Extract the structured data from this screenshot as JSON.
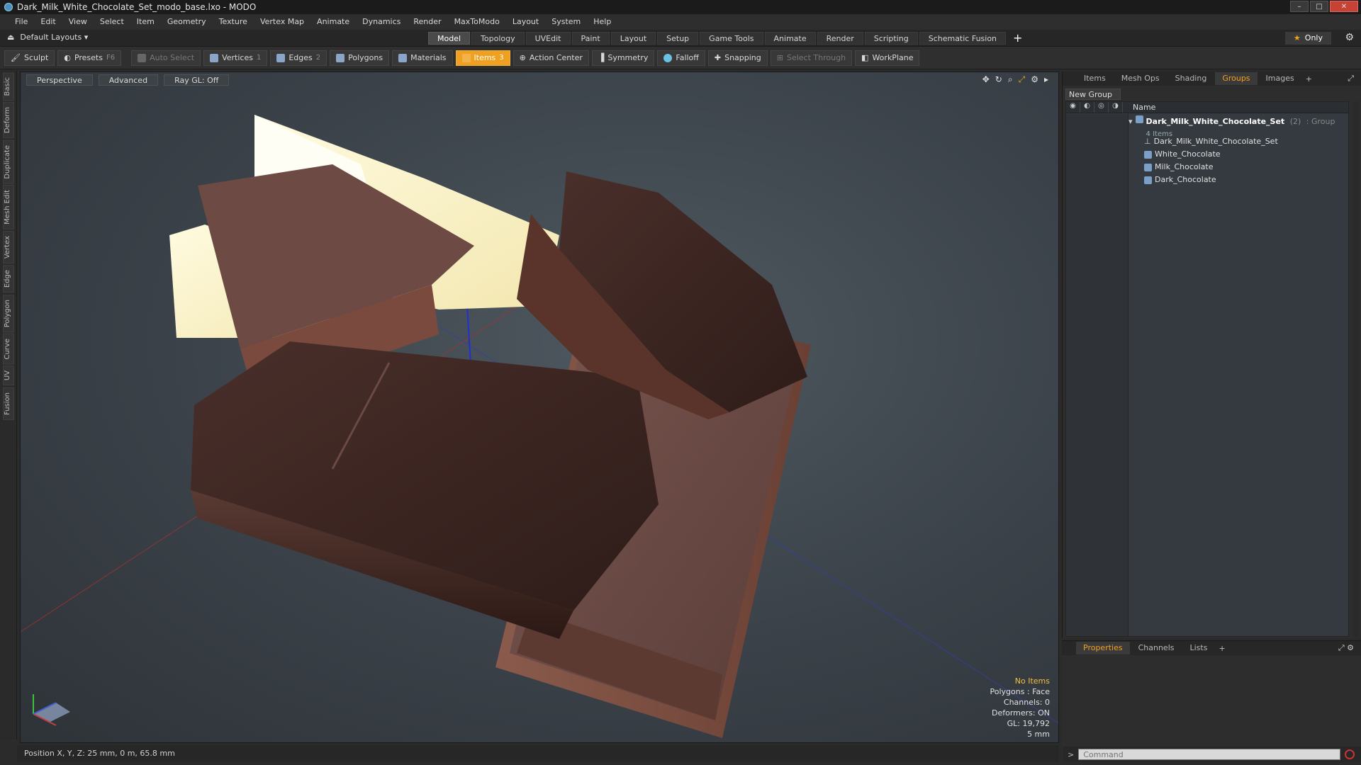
{
  "window": {
    "title": "Dark_Milk_White_Chocolate_Set_modo_base.lxo - MODO",
    "min": "–",
    "max": "□",
    "close": "✕"
  },
  "menu": [
    "File",
    "Edit",
    "View",
    "Select",
    "Item",
    "Geometry",
    "Texture",
    "Vertex Map",
    "Animate",
    "Dynamics",
    "Render",
    "MaxToModo",
    "Layout",
    "System",
    "Help"
  ],
  "layout_bar": {
    "layout_selector": "Default Layouts ▾",
    "tabs": [
      "Model",
      "Topology",
      "UVEdit",
      "Paint",
      "Layout",
      "Setup",
      "Game Tools",
      "Animate",
      "Render",
      "Scripting",
      "Schematic Fusion"
    ],
    "active_tab": "Model",
    "add": "+",
    "only": "Only"
  },
  "toolbar": {
    "sculpt": "Sculpt",
    "presets": "Presets",
    "presets_key": "F6",
    "auto_select": "Auto Select",
    "vertices": "Vertices",
    "vertices_count": "1",
    "edges": "Edges",
    "edges_count": "2",
    "polygons": "Polygons",
    "materials": "Materials",
    "items": "Items",
    "items_count": "3",
    "action_center": "Action Center",
    "symmetry": "Symmetry",
    "falloff": "Falloff",
    "snapping": "Snapping",
    "select_through": "Select Through",
    "workplane": "WorkPlane"
  },
  "left_tabs": [
    "Basic",
    "Deform",
    "Duplicate",
    "Mesh Edit",
    "Vertex",
    "Edge",
    "Polygon",
    "Curve",
    "UV",
    "Fusion"
  ],
  "viewport": {
    "view": "Perspective",
    "shading": "Advanced",
    "raygl": "Ray GL: Off",
    "info": {
      "items": "No Items",
      "polygons": "Polygons : Face",
      "channels": "Channels: 0",
      "deformers": "Deformers: ON",
      "gl": "GL: 19,792",
      "unit": "5 mm"
    }
  },
  "status": "Position X, Y, Z:  25 mm, 0 m, 65.8 mm",
  "right_panel": {
    "tabs": [
      "Items",
      "Mesh Ops",
      "Shading",
      "Groups",
      "Images"
    ],
    "active_tab": "Groups",
    "new_group": "New Group",
    "name_header": "Name",
    "group": {
      "name": "Dark_Milk_White_Chocolate_Set",
      "count": "(2)",
      "type": ": Group",
      "sub": "4 Items"
    },
    "children": [
      "Dark_Milk_White_Chocolate_Set",
      "White_Chocolate",
      "Milk_Chocolate",
      "Dark_Chocolate"
    ]
  },
  "props_panel": {
    "tabs": [
      "Properties",
      "Channels",
      "Lists"
    ],
    "active_tab": "Properties"
  },
  "command": {
    "prompt": ">",
    "placeholder": "Command"
  }
}
